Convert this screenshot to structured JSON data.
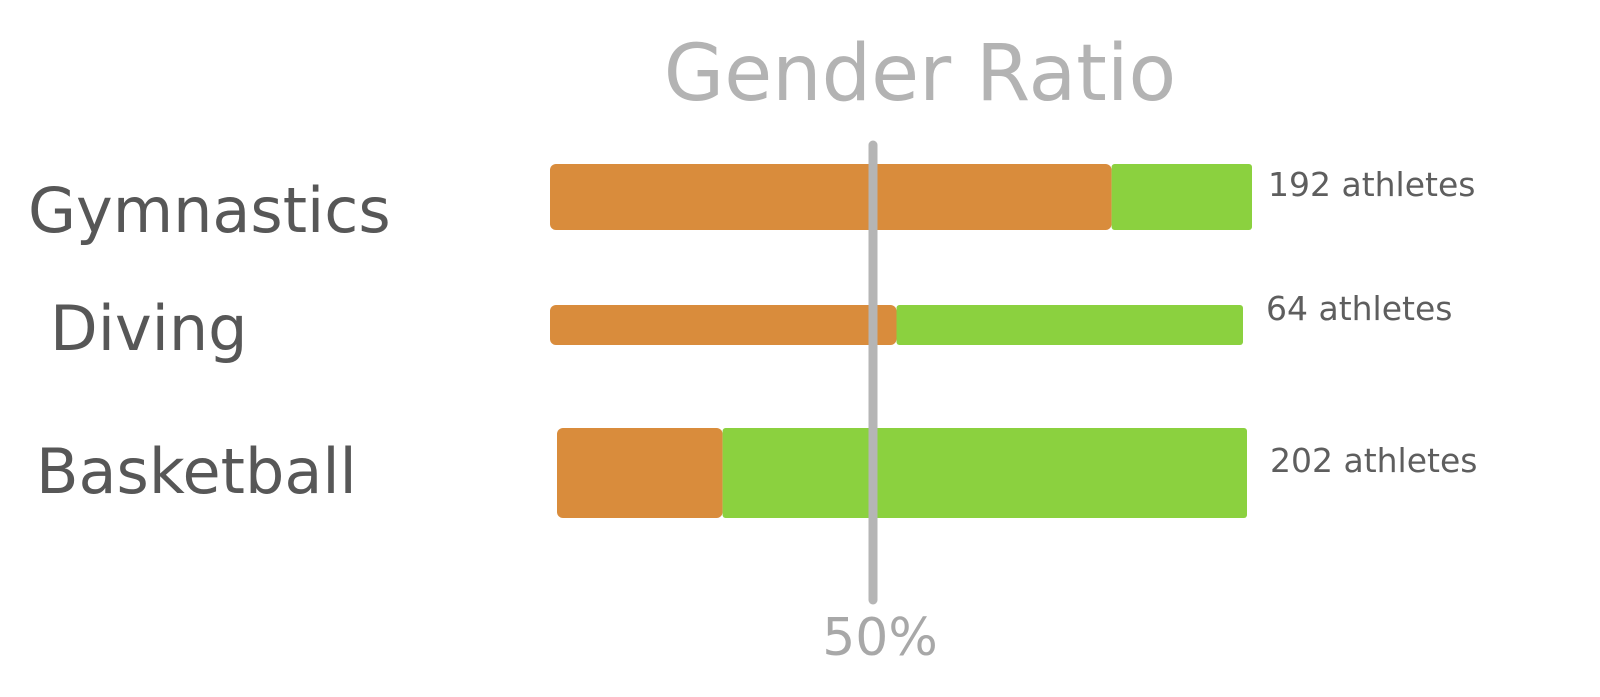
{
  "chart_data": {
    "type": "bar",
    "title": "Gender Ratio",
    "categories": [
      "Gymnastics",
      "Diving",
      "Basketball"
    ],
    "series": [
      {
        "values": [
          80,
          50,
          24
        ],
        "color": "#d98c3c"
      },
      {
        "values": [
          20,
          50,
          76
        ],
        "color": "#8bd13f"
      }
    ],
    "data_labels": [
      "192 athletes",
      "64 athletes",
      "202 athletes"
    ],
    "totals": [
      192,
      64,
      202
    ],
    "reference_line": {
      "value": 50,
      "label": "50%"
    },
    "xlim": [
      0,
      100
    ],
    "stacked": true,
    "normalized": true,
    "grid": false,
    "legend": "none",
    "colors": {
      "title": "#b3b3b3",
      "category_text": "#575757",
      "data_label_text": "#5e5e5e",
      "reference": "#b5b5b5"
    }
  }
}
